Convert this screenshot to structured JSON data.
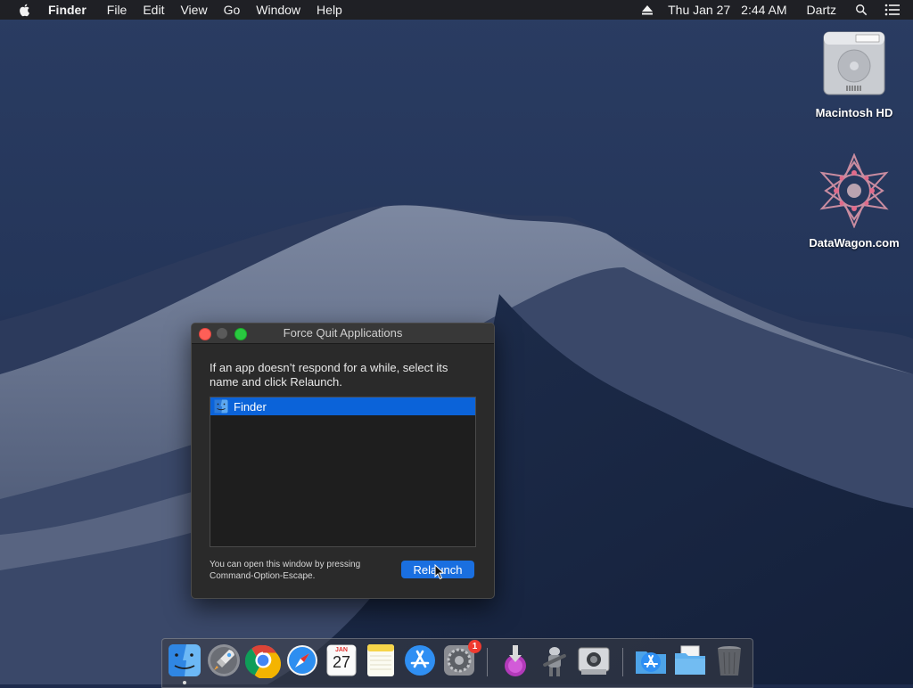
{
  "menubar": {
    "app_name": "Finder",
    "items": [
      "File",
      "Edit",
      "View",
      "Go",
      "Window",
      "Help"
    ],
    "date": "Thu Jan 27",
    "time": "2:44 AM",
    "user": "Dartz",
    "icons": [
      "apple-icon",
      "eject-icon",
      "spotlight-search-icon",
      "notification-center-icon"
    ]
  },
  "desktop": {
    "icons": [
      {
        "label": "Macintosh HD",
        "icon": "hard-drive-icon"
      },
      {
        "label": "DataWagon.com",
        "icon": "datawagon-icon"
      }
    ]
  },
  "force_quit": {
    "title": "Force Quit Applications",
    "description": "If an app doesn’t respond for a while, select its name and click Relaunch.",
    "apps": [
      {
        "name": "Finder",
        "icon": "finder-icon",
        "selected": true
      }
    ],
    "hint": "You can open this window by pressing Command-Option-Escape.",
    "button_label": "Relaunch"
  },
  "dock": {
    "items": [
      {
        "name": "Finder",
        "icon": "finder-icon",
        "running": true
      },
      {
        "name": "Launchpad",
        "icon": "launchpad-icon"
      },
      {
        "name": "Chrome",
        "icon": "chrome-icon"
      },
      {
        "name": "Safari",
        "icon": "safari-icon"
      },
      {
        "name": "Calendar",
        "icon": "calendar-icon",
        "month": "JAN",
        "day": "27"
      },
      {
        "name": "Notes",
        "icon": "notes-icon"
      },
      {
        "name": "App Store",
        "icon": "app-store-icon"
      },
      {
        "name": "System Preferences",
        "icon": "system-preferences-icon",
        "badge": "1"
      },
      {
        "name": "Downloads installer",
        "icon": "installer-icon"
      },
      {
        "name": "Automator",
        "icon": "automator-icon"
      },
      {
        "name": "Screenshot",
        "icon": "screenshot-icon"
      },
      {
        "name": "Applications",
        "icon": "applications-folder-icon"
      },
      {
        "name": "Documents",
        "icon": "folder-icon"
      },
      {
        "name": "Trash",
        "icon": "trash-icon"
      }
    ]
  },
  "colors": {
    "selection": "#0b63d9",
    "button": "#1a6fe0",
    "close": "#fe5f57",
    "zoom": "#29c840",
    "badge": "#f03a2f"
  }
}
